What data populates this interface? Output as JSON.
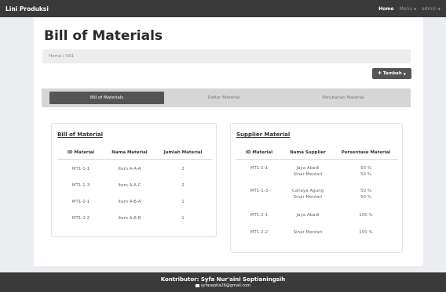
{
  "navbar": {
    "brand": "Lini Produksi",
    "home": "Home",
    "menu": "Menu",
    "user": "admin"
  },
  "page": {
    "title": "Bill of Materials",
    "breadcrumb": "Home / V01",
    "add_button": "Tambah"
  },
  "tabs": [
    "Bill of Materials",
    "Daftar Material",
    "Perubahan Material"
  ],
  "bom_card": {
    "title": "Bill of Material",
    "columns": [
      "ID Material",
      "Nama Material",
      "Jumlah Material"
    ],
    "rows": [
      {
        "id": "MT1-1-1",
        "name": "Item A-A-A",
        "qty": "2"
      },
      {
        "id": "MT1-1-3",
        "name": "Item A-A-C",
        "qty": "2"
      },
      {
        "id": "MT1-2-1",
        "name": "Item A-B-A",
        "qty": "1"
      },
      {
        "id": "MT1-2-2",
        "name": "Item A-B-B",
        "qty": "1"
      }
    ]
  },
  "supplier_card": {
    "title": "Supplier Material",
    "columns": [
      "ID Material",
      "Nama Supplier",
      "Persentase Material"
    ],
    "rows": [
      {
        "id": "MT1-1-1",
        "suppliers": [
          "Jaya Abadi",
          "Sinar Mentari"
        ],
        "percents": [
          "50 %",
          "50 %"
        ]
      },
      {
        "id": "MT1-1-3",
        "suppliers": [
          "Cahaya Agung",
          "Sinar Mentari"
        ],
        "percents": [
          "50 %",
          "50 %"
        ]
      },
      {
        "id": "MT1-2-1",
        "suppliers": [
          "Jaya Abadi"
        ],
        "percents": [
          "100 %"
        ]
      },
      {
        "id": "MT1-2-2",
        "suppliers": [
          "Sinar Mentari"
        ],
        "percents": [
          "100 %"
        ]
      }
    ]
  },
  "footer": {
    "contributor": "Kontributor: Syfa Nur'aini Septianingsih",
    "email": "syfaseptia26@gmail.com"
  }
}
